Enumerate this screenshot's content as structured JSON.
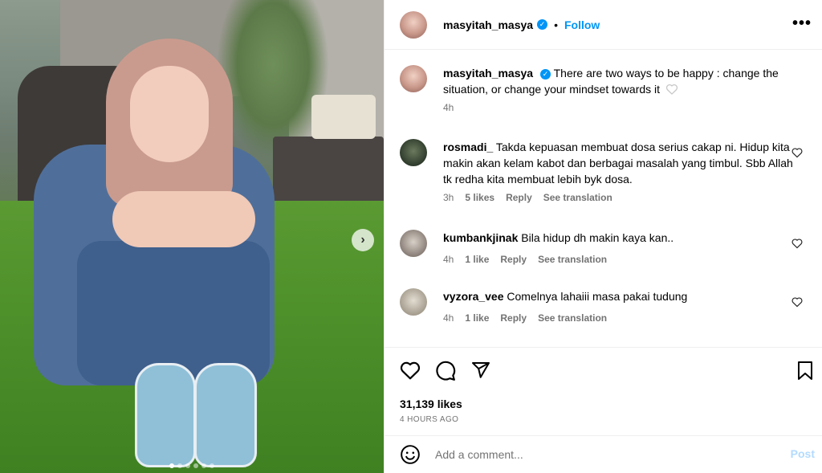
{
  "post": {
    "username": "masyitah_masya",
    "verified": true,
    "follow_label": "Follow",
    "separator": "•",
    "more_label": "•••",
    "next_glyph": "›",
    "dot_count": 6,
    "active_dot": 0
  },
  "caption": {
    "username": "masyitah_masya",
    "text": "There are two ways to be happy : change the situation, or change your mindset towards it",
    "time": "4h"
  },
  "comments": [
    {
      "username": "rosmadi_",
      "text": "Takda kepuasan membuat dosa serius cakap ni. Hidup kita makin akan kelam kabot dan berbagai masalah yang timbul. Sbb Allah tk redha kita membuat lebih byk dosa.",
      "time": "3h",
      "likes": "5 likes",
      "reply": "Reply",
      "translate": "See translation",
      "avatar_color": "#2f3b2c"
    },
    {
      "username": "kumbankjinak",
      "text": "Bila hidup dh makin kaya kan..",
      "time": "4h",
      "likes": "1 like",
      "reply": "Reply",
      "translate": "See translation",
      "avatar_color": "#8a7f78"
    },
    {
      "username": "vyzora_vee",
      "text": "Comelnya lahaiii masa pakai tudung",
      "time": "4h",
      "likes": "1 like",
      "reply": "Reply",
      "translate": "See translation",
      "avatar_color": "#a59d8e"
    }
  ],
  "stats": {
    "likes": "31,139 likes",
    "time_ago": "4 HOURS AGO"
  },
  "compose": {
    "placeholder": "Add a comment...",
    "post_label": "Post"
  },
  "icons": {
    "like": "heart-icon",
    "comment": "comment-icon",
    "share": "paper-plane-icon",
    "save": "bookmark-icon",
    "emoji": "smiley-icon",
    "more": "ellipsis-icon"
  },
  "colors": {
    "accent": "#0095f6",
    "muted": "#737373",
    "post_disabled": "#b3dbff"
  }
}
